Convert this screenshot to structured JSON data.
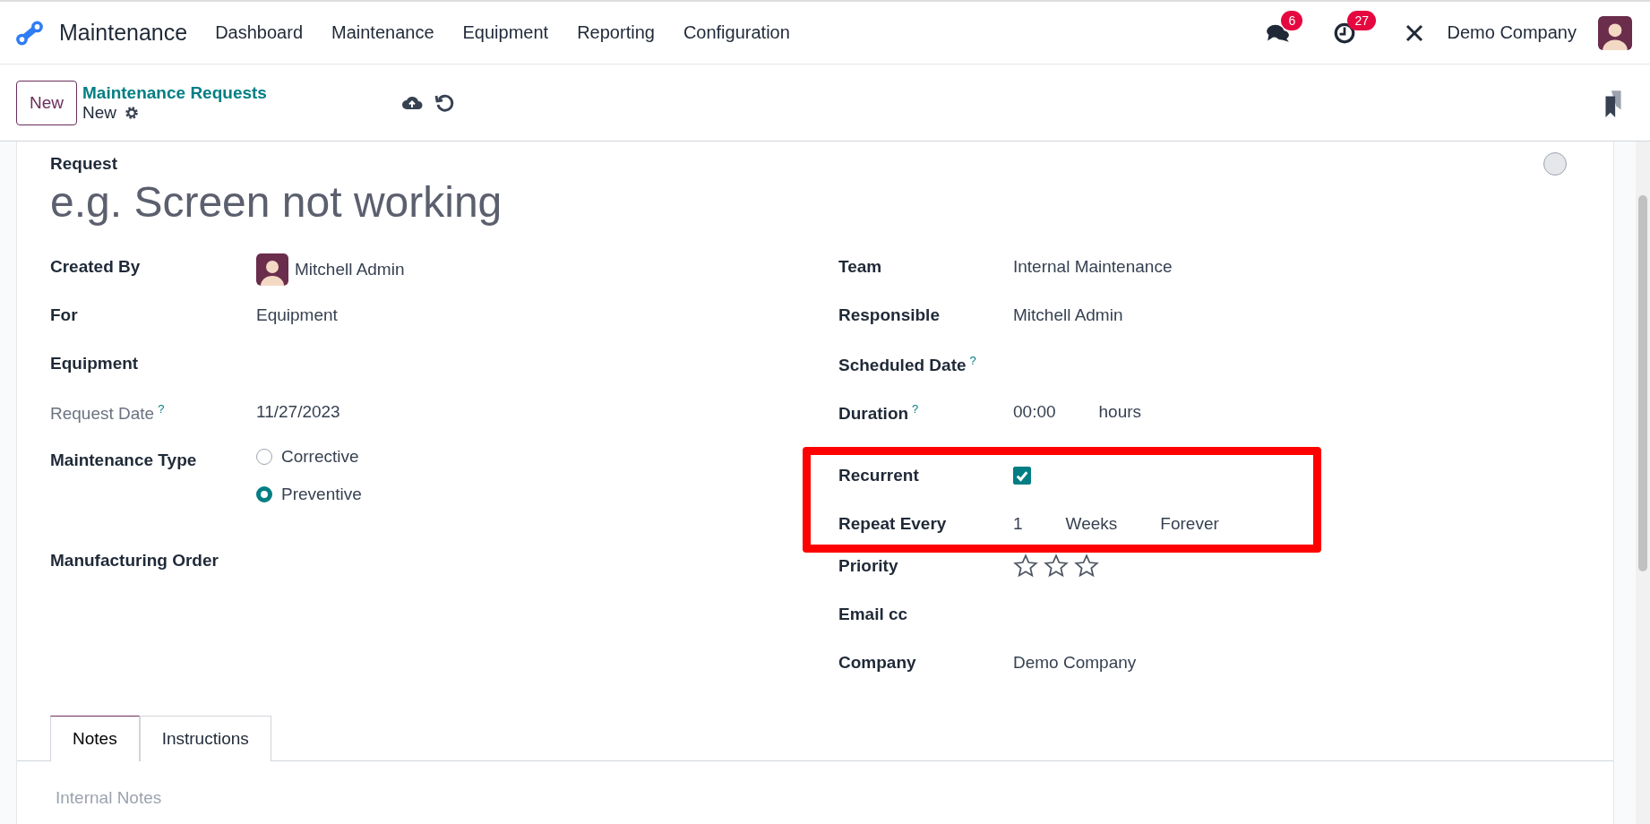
{
  "navbar": {
    "app_name": "Maintenance",
    "menu": [
      "Dashboard",
      "Maintenance",
      "Equipment",
      "Reporting",
      "Configuration"
    ],
    "messages_badge": "6",
    "activities_badge": "27",
    "company": "Demo Company"
  },
  "control_panel": {
    "new_button": "New",
    "breadcrumb": "Maintenance Requests",
    "record": "New"
  },
  "form": {
    "request_label": "Request",
    "title_placeholder": "e.g. Screen not working",
    "left": [
      {
        "kind": "avatar",
        "label": "Created By",
        "value": "Mitchell Admin"
      },
      {
        "kind": "text",
        "label": "For",
        "value": "Equipment"
      },
      {
        "kind": "text",
        "label": "Equipment"
      },
      {
        "kind": "text",
        "label": "Request Date",
        "help": "?",
        "muted": true,
        "value": "11/27/2023"
      },
      {
        "kind": "radio",
        "label": "Maintenance Type",
        "options": [
          {
            "label": "Corrective",
            "selected": false
          },
          {
            "label": "Preventive",
            "selected": true
          }
        ]
      },
      {
        "kind": "text",
        "label": "Manufacturing Order"
      }
    ],
    "right": [
      {
        "kind": "text",
        "label": "Team",
        "value": "Internal Maintenance"
      },
      {
        "kind": "text",
        "label": "Responsible",
        "value": "Mitchell Admin"
      },
      {
        "kind": "text",
        "label": "Scheduled Date",
        "help": "?"
      },
      {
        "kind": "parts",
        "label": "Duration",
        "help": "?",
        "parts": [
          "00:00",
          "hours"
        ]
      },
      {
        "kind": "checkbox",
        "label": "Recurrent",
        "checked": true,
        "highlighted": true
      },
      {
        "kind": "parts",
        "label": "Repeat Every",
        "parts": [
          "1",
          "Weeks",
          "Forever"
        ],
        "highlighted": true
      },
      {
        "kind": "stars",
        "label": "Priority",
        "stars": 0
      },
      {
        "kind": "text",
        "label": "Email cc"
      },
      {
        "kind": "text",
        "label": "Company",
        "value": "Demo Company"
      }
    ],
    "tabs": [
      {
        "label": "Notes",
        "selected": true
      },
      {
        "label": "Instructions",
        "selected": false
      }
    ],
    "notes_placeholder": "Internal Notes"
  }
}
